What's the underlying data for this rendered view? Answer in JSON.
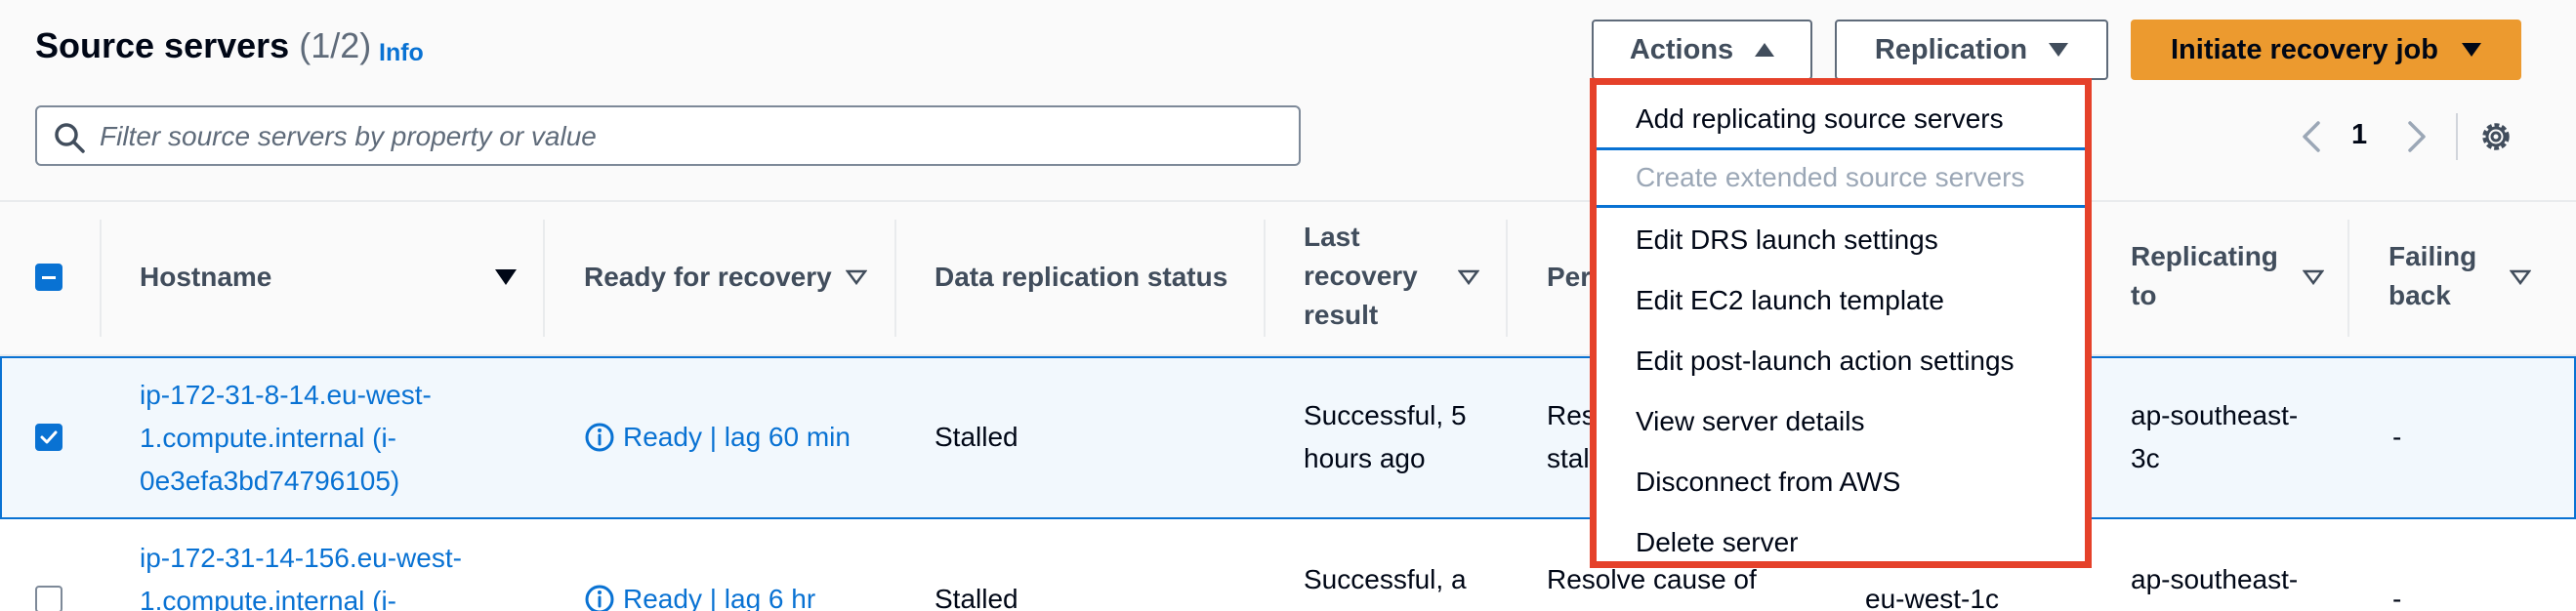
{
  "header": {
    "title": "Source servers",
    "count": "(1/2)",
    "info": "Info",
    "actions_label": "Actions",
    "replication_label": "Replication",
    "primary_label": "Initiate recovery job"
  },
  "search": {
    "placeholder": "Filter source servers by property or value"
  },
  "pagination": {
    "current": "1"
  },
  "table": {
    "columns": {
      "hostname": "Hostname",
      "ready": "Ready for recovery",
      "data_replication": "Data replication status",
      "last_recovery_1": "Last",
      "last_recovery_2": "recovery",
      "last_recovery_3": "result",
      "pending_partial": "Per",
      "replicating_1": "Replicating",
      "replicating_2": "to",
      "failing_1": "Failing",
      "failing_2": "back"
    },
    "rows": [
      {
        "host_1": "ip-172-31-8-14.eu-west-",
        "host_2": "1.compute.internal (i-",
        "host_3": "0e3efa3bd74796105)",
        "ready": "Ready | lag 60 min",
        "replication": "Stalled",
        "last_1": "Successful, 5",
        "last_2": "hours ago",
        "pending_1": "Res",
        "pending_2": "stal",
        "replicating_1": "ap-southeast-",
        "replicating_2": "3c",
        "failing": "-"
      },
      {
        "host_1": "ip-172-31-14-156.eu-west-",
        "host_2": "1.compute.internal (i-",
        "ready": "Ready | lag 6 hr",
        "replication": "Stalled",
        "last_1": "Successful, a",
        "pending_1": "Resolve cause of",
        "region": "eu-west-1c",
        "replicating_1": "ap-southeast-",
        "failing": "-"
      }
    ]
  },
  "actions_menu": {
    "items": [
      "Add replicating source servers",
      "Create extended source servers",
      "Edit DRS launch settings",
      "Edit EC2 launch template",
      "Edit post-launch action settings",
      "View server details",
      "Disconnect from AWS",
      "Delete server"
    ]
  },
  "colors": {
    "accent": "#0972d3",
    "primary_button": "#ec9a2f",
    "highlight_border": "#e5412a"
  }
}
